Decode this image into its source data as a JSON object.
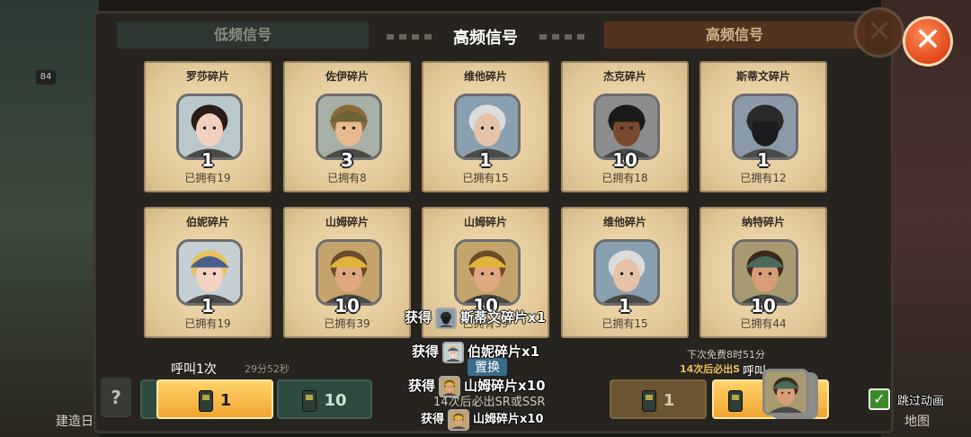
{
  "tabs": {
    "left": "低频信号",
    "center": "高频信号",
    "right": "高频信号"
  },
  "cards": [
    {
      "name": "罗莎碎片",
      "count": "1",
      "owned": "已拥有19",
      "portrait": "female-dark-hair"
    },
    {
      "name": "佐伊碎片",
      "count": "3",
      "owned": "已拥有8",
      "portrait": "male-helmet-goggles"
    },
    {
      "name": "维他碎片",
      "count": "1",
      "owned": "已拥有15",
      "portrait": "male-grey-hair"
    },
    {
      "name": "杰克碎片",
      "count": "10",
      "owned": "已拥有18",
      "portrait": "male-pirate-eyepatch"
    },
    {
      "name": "斯蒂文碎片",
      "count": "1",
      "owned": "已拥有12",
      "portrait": "male-masked-goggles"
    },
    {
      "name": "伯妮碎片",
      "count": "1",
      "owned": "已拥有19",
      "portrait": "female-blue-helmet"
    },
    {
      "name": "山姆碎片",
      "count": "10",
      "owned": "已拥有39",
      "portrait": "male-yellow-helmet"
    },
    {
      "name": "山姆碎片",
      "count": "10",
      "owned": "已拥有39",
      "portrait": "male-yellow-helmet"
    },
    {
      "name": "维他碎片",
      "count": "1",
      "owned": "已拥有15",
      "portrait": "male-grey-hair"
    },
    {
      "name": "纳特碎片",
      "count": "10",
      "owned": "已拥有44",
      "portrait": "male-green-beret"
    }
  ],
  "buttons": {
    "call_once_label": "呼叫1次",
    "call_once_cost": "1",
    "call_ten_cost": "10",
    "right_call_once_cost": "1",
    "help": "?",
    "right_call_partial": "呼叫"
  },
  "notes": {
    "left_timer": "29分52秒",
    "right_next_free": "下次免费8时51分",
    "right_guarantee": "14次后必出S",
    "center_guarantee": "14次后必出SR或SSR",
    "center_button": "置换"
  },
  "notifications": [
    {
      "prefix": "获得",
      "text": "斯蒂文碎片x1",
      "portrait": "male-masked-goggles"
    },
    {
      "prefix": "获得",
      "text": "伯妮碎片x1",
      "portrait": "female-blue-helmet"
    },
    {
      "prefix": "获得",
      "text": "山姆碎片x10",
      "portrait": "male-yellow-helmet"
    },
    {
      "prefix": "获得",
      "text": "山姆碎片x10",
      "portrait": "male-yellow-helmet"
    }
  ],
  "skip_animation": {
    "label": "跳过动画",
    "checked": true
  },
  "side_labels": {
    "left_badge": "84",
    "left_bottom": "建造日",
    "right_bottom": "地图"
  },
  "colors": {
    "accent": "#f0a530",
    "close": "#e2481c",
    "card_bg": "#e8d3a6"
  }
}
